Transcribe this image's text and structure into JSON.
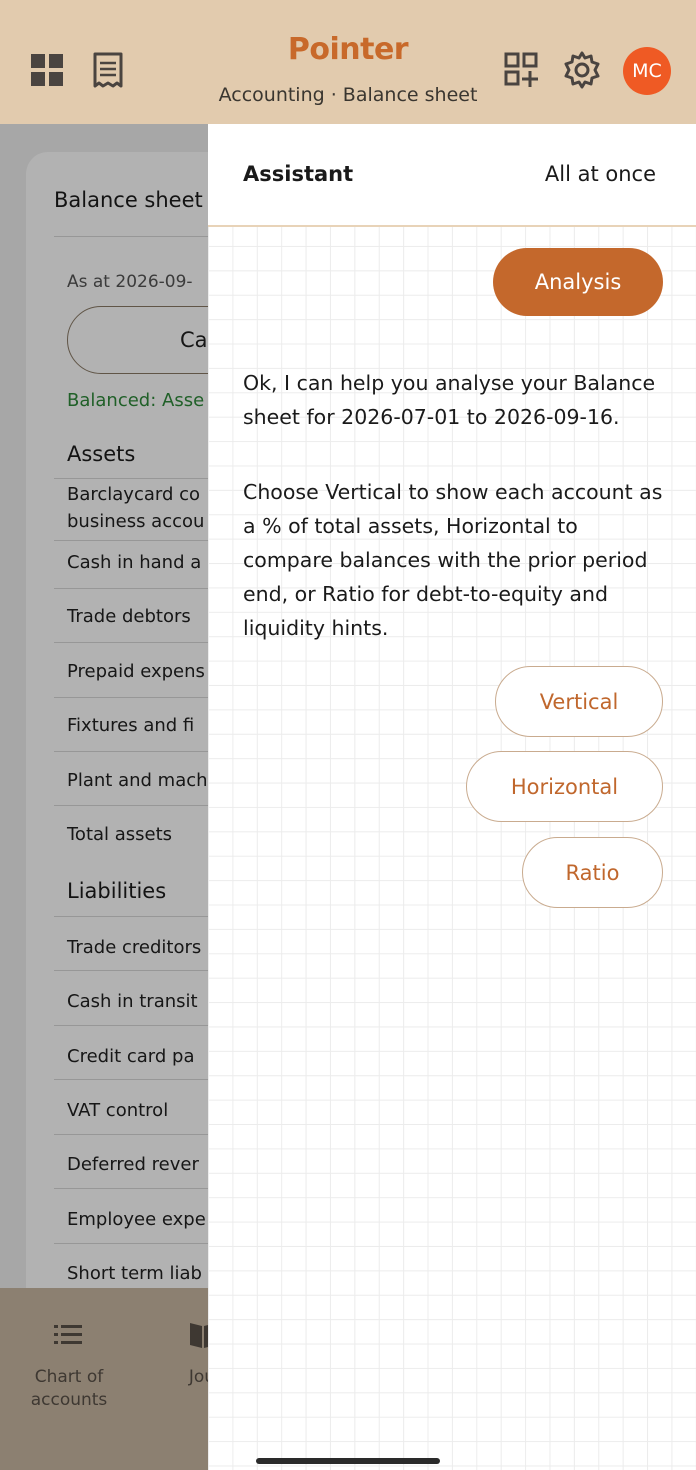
{
  "header": {
    "brand": "Pointer",
    "subtitle": "Accounting · Balance sheet",
    "avatar_initials": "MC",
    "icons": [
      "dashboard-icon",
      "receipt-icon",
      "qr-add-icon",
      "gear-icon"
    ]
  },
  "balance_sheet": {
    "title": "Balance sheet",
    "as_at": "As at 2026-09-",
    "calc_button": "Ca",
    "balanced_text": "Balanced: Asse",
    "assets_heading": "Assets",
    "assets": [
      {
        "label": "Barclaycard co"
      },
      {
        "label": "business accou"
      },
      {
        "label": "Cash in hand a"
      },
      {
        "label": "Trade debtors"
      },
      {
        "label": "Prepaid expens"
      },
      {
        "label": "Fixtures and fi"
      },
      {
        "label": "Plant and mach"
      },
      {
        "label": "Total assets"
      }
    ],
    "liabilities_heading": "Liabilities",
    "liabilities": [
      {
        "label": "Trade creditors"
      },
      {
        "label": "Cash in transit"
      },
      {
        "label": "Credit card pa"
      },
      {
        "label": "VAT control"
      },
      {
        "label": "Deferred rever"
      },
      {
        "label": "Employee expe"
      },
      {
        "label": "Short term liab"
      }
    ]
  },
  "bottom_nav": {
    "items": [
      {
        "label_line1": "Chart of",
        "label_line2": "accounts",
        "icon": "list-icon"
      },
      {
        "label_line1": "Jou",
        "label_line2": "",
        "icon": "book-icon"
      }
    ]
  },
  "assistant": {
    "title": "Assistant",
    "mode": "All at once",
    "selected_chip": "Analysis",
    "message_1": "Ok, I can help you analyse your Balance sheet for 2026-07-01 to 2026-09-16.",
    "message_2": "Choose Vertical to show each account as a % of total assets, Horizontal to compare balances with the prior period end, or Ratio for debt-to-equity and liquidity hints.",
    "options": [
      "Vertical",
      "Horizontal",
      "Ratio"
    ]
  },
  "colors": {
    "header_bg": "#e2cbae",
    "brand": "#c8692a",
    "accent": "#c4682c",
    "avatar_bg": "#ef5a24",
    "balanced_green": "#2e8a3a"
  }
}
